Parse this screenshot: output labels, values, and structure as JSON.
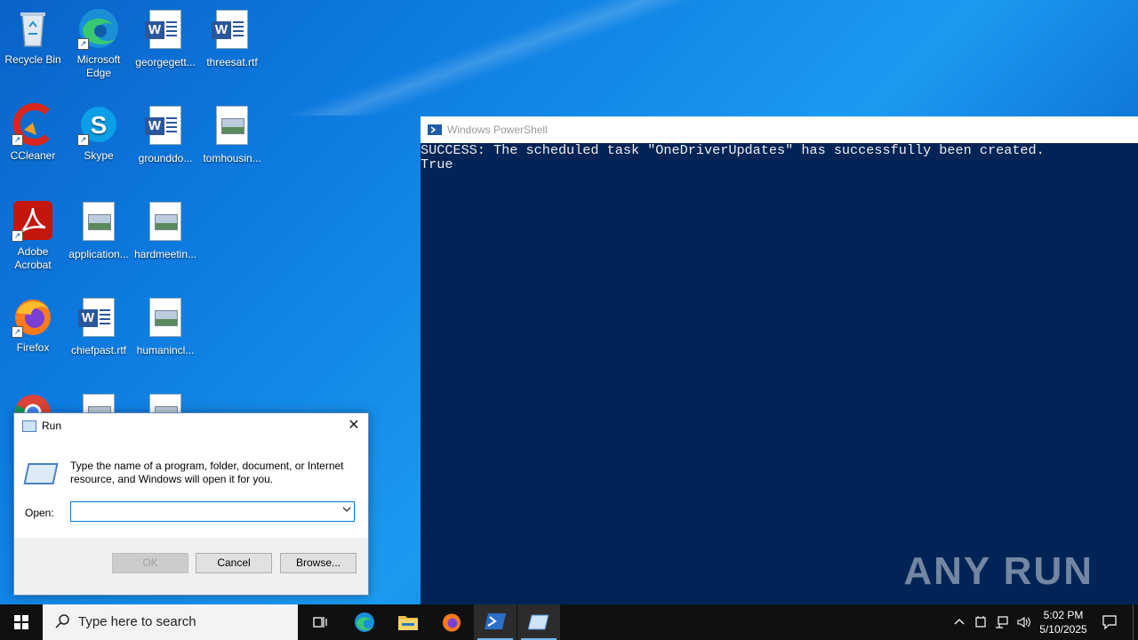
{
  "desktop": {
    "icons": [
      {
        "label": "Recycle Bin",
        "icon": "recycle-bin-icon"
      },
      {
        "label": "Microsoft Edge",
        "icon": "edge-icon"
      },
      {
        "label": "georgegett...",
        "icon": "word-doc-icon"
      },
      {
        "label": "threesat.rtf",
        "icon": "word-doc-icon"
      },
      {
        "label": "CCleaner",
        "icon": "ccleaner-icon"
      },
      {
        "label": "Skype",
        "icon": "skype-icon"
      },
      {
        "label": "grounddo...",
        "icon": "word-doc-icon"
      },
      {
        "label": "tomhousin...",
        "icon": "image-doc-icon"
      },
      {
        "label": "Adobe Acrobat",
        "icon": "adobe-acrobat-icon"
      },
      {
        "label": "application...",
        "icon": "image-doc-icon"
      },
      {
        "label": "hardmeetin...",
        "icon": "image-doc-icon"
      },
      {
        "label": "Firefox",
        "icon": "firefox-icon"
      },
      {
        "label": "chiefpast.rtf",
        "icon": "word-doc-icon"
      },
      {
        "label": "humanincl...",
        "icon": "image-doc-icon"
      }
    ]
  },
  "powershell": {
    "title": "Windows PowerShell",
    "output_line1": "SUCCESS: The scheduled task \"OneDriverUpdates\" has successfully been created.",
    "output_line2": "True"
  },
  "watermark": "ANY RUN",
  "run_dialog": {
    "title": "Run",
    "close": "✕",
    "description": "Type the name of a program, folder, document, or Internet resource, and Windows will open it for you.",
    "open_label": "Open:",
    "open_value": "",
    "ok_label": "OK",
    "cancel_label": "Cancel",
    "browse_label": "Browse..."
  },
  "taskbar": {
    "search_placeholder": "Type here to search",
    "clock_time": "5:02 PM",
    "clock_date": "5/10/2025"
  }
}
